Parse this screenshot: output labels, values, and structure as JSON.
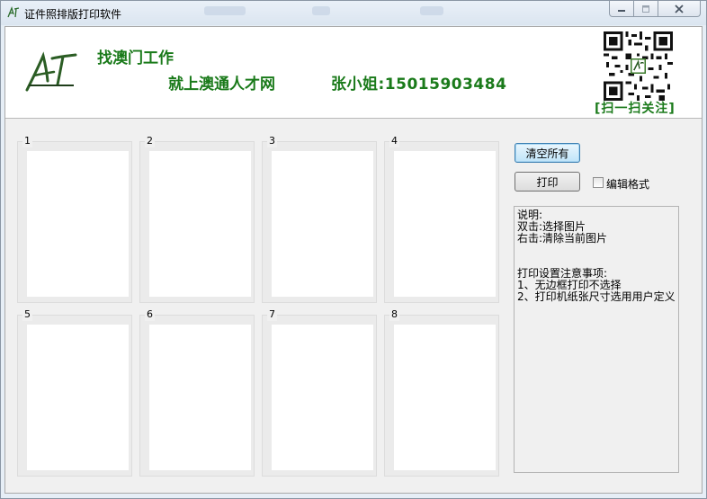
{
  "window": {
    "title": "证件照排版打印软件",
    "controls": {
      "minimize": "minimize-icon",
      "maximize": "maximize-icon",
      "close": "close-icon"
    }
  },
  "banner": {
    "logo_text": "AT",
    "line1": "找澳门工作",
    "line2": "就上澳通人才网",
    "contact": "张小姐:15015903484",
    "scan_label": "[扫一扫关注]",
    "brand_color": "#1a7a1a"
  },
  "slots": [
    {
      "label": "1"
    },
    {
      "label": "2"
    },
    {
      "label": "3"
    },
    {
      "label": "4"
    },
    {
      "label": "5"
    },
    {
      "label": "6"
    },
    {
      "label": "7"
    },
    {
      "label": "8"
    }
  ],
  "controls": {
    "clear_all": "清空所有",
    "print": "打印",
    "edit_format": "编辑格式",
    "edit_format_checked": false
  },
  "notes": [
    "说明:",
    "双击:选择图片",
    "右击:清除当前图片",
    "",
    "",
    "打印设置注意事项:",
    "1、无边框打印不选择",
    "2、打印机纸张尺寸选用用户定义"
  ]
}
